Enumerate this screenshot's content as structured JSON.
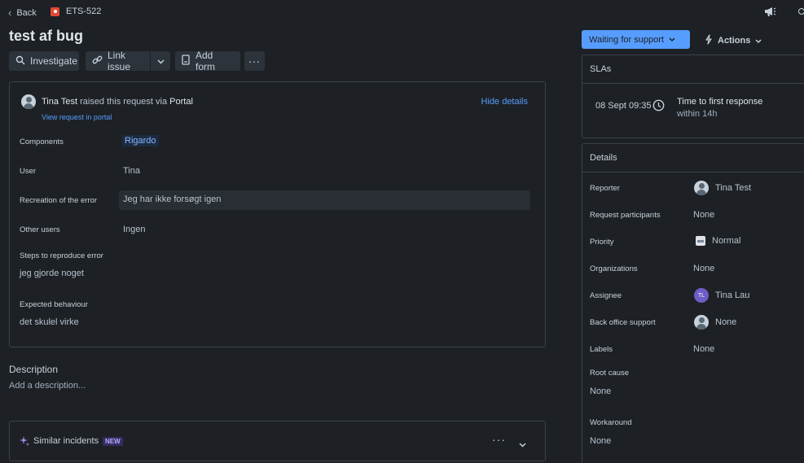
{
  "header": {
    "back_label": "Back",
    "issue_key": "ETS-522",
    "title": "test af bug"
  },
  "toolbar": {
    "investigate_label": "Investigate",
    "link_issue_label": "Link issue",
    "add_form_label": "Add form"
  },
  "request": {
    "reporter_name": "Tina Test",
    "raised_text": "raised this request via",
    "channel": "Portal",
    "view_portal_link": "View request in portal",
    "hide_details": "Hide details"
  },
  "fields": {
    "components_label": "Components",
    "components_value": "Rigardo",
    "user_label": "User",
    "user_value": "Tina",
    "recreation_label": "Recreation of the error",
    "recreation_value": "Jeg har ikke forsøgt igen",
    "other_users_label": "Other users",
    "other_users_value": "Ingen",
    "steps_label": "Steps to reproduce error",
    "steps_value": "jeg gjorde noget",
    "expected_label": "Expected behaviour",
    "expected_value": "det skulel virke"
  },
  "description": {
    "heading": "Description",
    "placeholder": "Add a description..."
  },
  "similar": {
    "label": "Similar incidents",
    "badge": "NEW"
  },
  "status": {
    "label": "Waiting for support",
    "actions_label": "Actions"
  },
  "sla": {
    "heading": "SLAs",
    "time": "08 Sept 09:35",
    "title": "Time to first response",
    "subtitle": "within 14h"
  },
  "details": {
    "heading": "Details",
    "reporter_label": "Reporter",
    "reporter_value": "Tina Test",
    "participants_label": "Request participants",
    "participants_value": "None",
    "priority_label": "Priority",
    "priority_value": "Normal",
    "organizations_label": "Organizations",
    "organizations_value": "None",
    "assignee_label": "Assignee",
    "assignee_initials": "TL",
    "assignee_value": "Tina Lau",
    "backoffice_label": "Back office support",
    "backoffice_value": "None",
    "labels_label": "Labels",
    "labels_value": "None",
    "rootcause_label": "Root cause",
    "rootcause_value": "None",
    "workaround_label": "Workaround",
    "workaround_value": "None"
  },
  "colors": {
    "background": "#1d2125",
    "accent": "#579dff",
    "status_button": "#579dff",
    "issue_type_red": "#e34935",
    "badge_purple": "#352c63",
    "assignee_avatar": "#6e5dc6"
  }
}
